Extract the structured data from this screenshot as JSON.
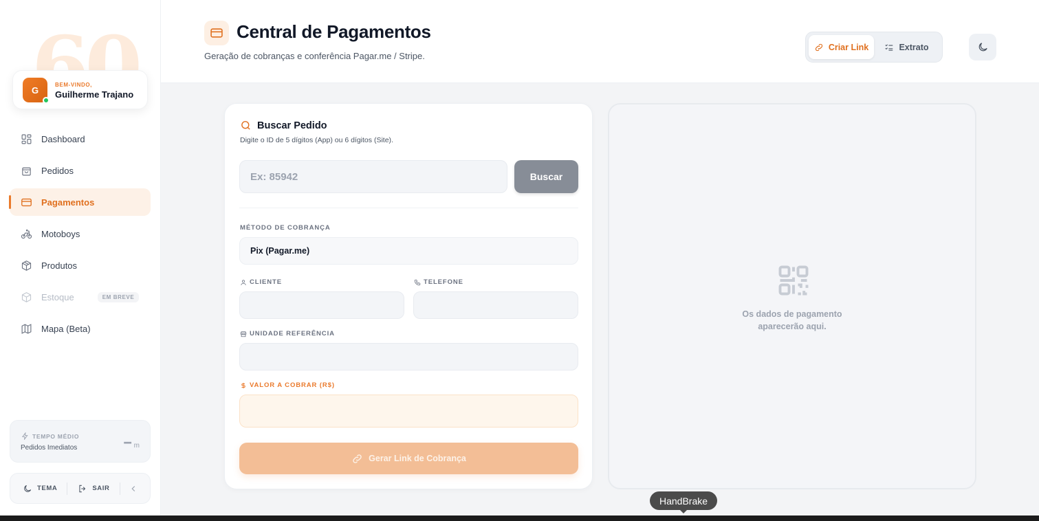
{
  "sidebar": {
    "bg_number": "60",
    "user": {
      "initial": "G",
      "welcome": "BEM-VINDO,",
      "name": "Guilherme Trajano",
      "status_color": "#22c55e"
    },
    "nav": [
      {
        "label": "Dashboard",
        "icon": "dashboard-icon"
      },
      {
        "label": "Pedidos",
        "icon": "shopping-bag-icon"
      },
      {
        "label": "Pagamentos",
        "icon": "credit-card-icon",
        "active": true
      },
      {
        "label": "Motoboys",
        "icon": "bike-icon"
      },
      {
        "label": "Produtos",
        "icon": "box-icon"
      },
      {
        "label": "Estoque",
        "icon": "package-icon",
        "disabled": true,
        "badge": "EM BREVE"
      },
      {
        "label": "Mapa (Beta)",
        "icon": "map-icon"
      }
    ],
    "avg": {
      "title": "TEMPO MÉDIO",
      "subtitle": "Pedidos Imediatos",
      "value": "--",
      "unit": "m"
    },
    "bottom": {
      "theme_label": "TEMA",
      "logout_label": "SAIR"
    }
  },
  "header": {
    "title": "Central de Pagamentos",
    "subtitle": "Geração de cobranças e conferência Pagar.me / Stripe.",
    "tabs": [
      {
        "label": "Criar Link",
        "active": true
      },
      {
        "label": "Extrato"
      }
    ]
  },
  "form": {
    "title": "Buscar Pedido",
    "subtitle": "Digite o ID de 5 dígitos (App) ou 6 dígitos (Site).",
    "order_placeholder": "Ex: 85942",
    "search_label": "Buscar",
    "method_label": "MÉTODO DE COBRANÇA",
    "method_value": "Pix (Pagar.me)",
    "client_label": "CLIENTE",
    "phone_label": "TELEFONE",
    "unit_label": "UNIDADE REFERÊNCIA",
    "value_label": "VALOR A COBRAR (R$)",
    "generate_label": "Gerar Link de Cobrança"
  },
  "result": {
    "line1": "Os dados de pagamento",
    "line2": "aparecerão aqui."
  },
  "tooltip": "HandBrake",
  "colors": {
    "accent": "#ea7a2c",
    "accent_soft": "#fdf1e7"
  }
}
